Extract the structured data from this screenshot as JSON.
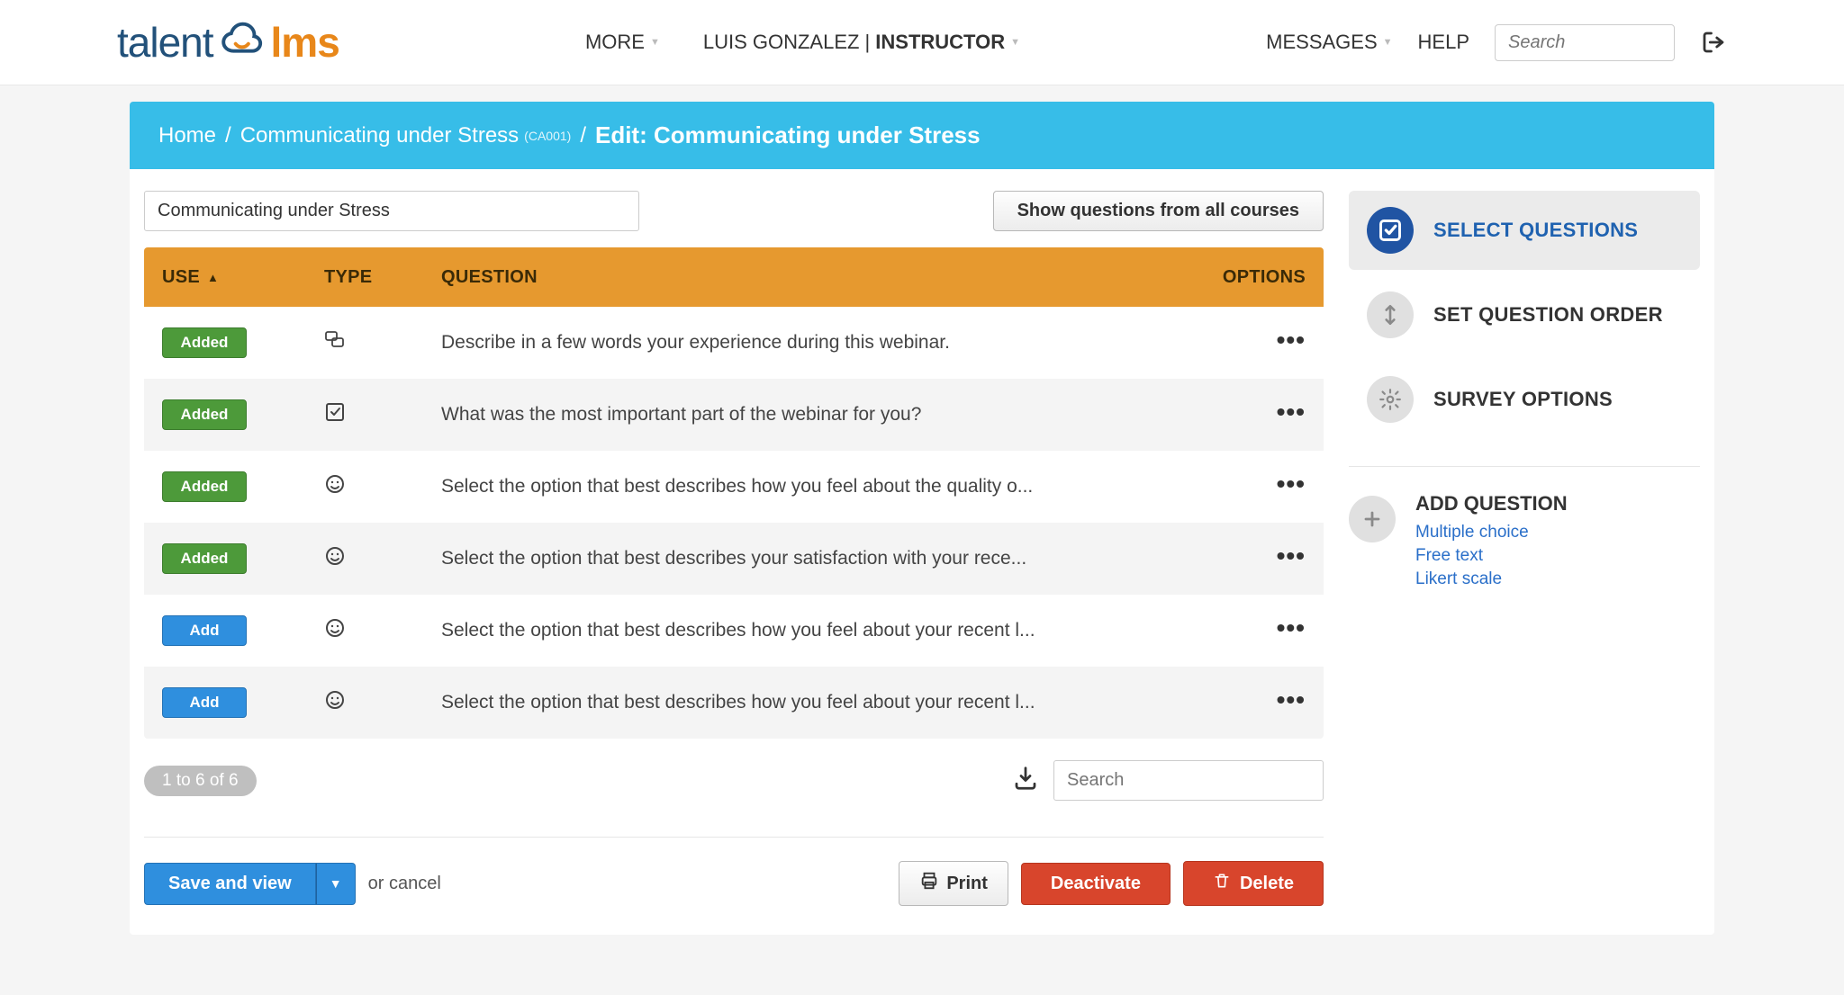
{
  "header": {
    "logo_left": "talent",
    "logo_right": "lms",
    "nav": {
      "more": "MORE",
      "user_prefix": "LUIS GONZALEZ |",
      "user_role": "INSTRUCTOR",
      "messages": "MESSAGES",
      "help": "HELP",
      "search_placeholder": "Search"
    }
  },
  "breadcrumb": {
    "home": "Home",
    "course": "Communicating under Stress",
    "code": "(CA001)",
    "title": "Edit: Communicating under Stress"
  },
  "toolbar": {
    "course_input": "Communicating under Stress",
    "show_all": "Show questions from all courses"
  },
  "table": {
    "headers": {
      "use": "USE",
      "type": "TYPE",
      "question": "QUESTION",
      "options": "OPTIONS"
    },
    "rows": [
      {
        "badge": "Added",
        "badge_kind": "added",
        "type": "freetext",
        "question": "Describe in a few words your experience during this webinar."
      },
      {
        "badge": "Added",
        "badge_kind": "added",
        "type": "multiple",
        "question": "What was the most important part of the webinar for you?"
      },
      {
        "badge": "Added",
        "badge_kind": "added",
        "type": "likert",
        "question": "Select the option that best describes how you feel about the quality o..."
      },
      {
        "badge": "Added",
        "badge_kind": "added",
        "type": "likert",
        "question": "Select the option that best describes your satisfaction with your rece..."
      },
      {
        "badge": "Add",
        "badge_kind": "add",
        "type": "likert",
        "question": "Select the option that best describes how you feel about your recent l..."
      },
      {
        "badge": "Add",
        "badge_kind": "add",
        "type": "likert",
        "question": "Select the option that best describes how you feel about your recent l..."
      }
    ],
    "pager": "1 to 6 of 6",
    "search_placeholder": "Search"
  },
  "actions": {
    "save": "Save and view",
    "or": "or",
    "cancel": "cancel",
    "print": "Print",
    "deactivate": "Deactivate",
    "delete": "Delete"
  },
  "side": {
    "select": "SELECT QUESTIONS",
    "order": "SET QUESTION ORDER",
    "options": "SURVEY OPTIONS",
    "add_title": "ADD QUESTION",
    "add_links": {
      "mc": "Multiple choice",
      "ft": "Free text",
      "lk": "Likert scale"
    }
  }
}
